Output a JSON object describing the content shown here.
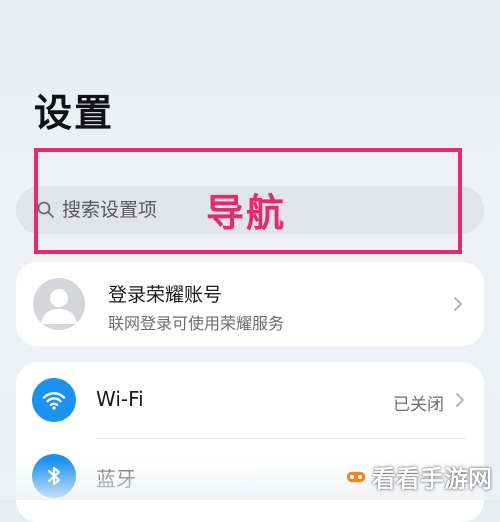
{
  "header": {
    "title": "设置"
  },
  "search": {
    "placeholder": "搜索设置项",
    "icon": "search-icon"
  },
  "annotation": {
    "label": "导航",
    "color": "#e52a6f"
  },
  "account": {
    "title": "登录荣耀账号",
    "subtitle": "联网登录可使用荣耀服务",
    "icon": "avatar-placeholder-icon"
  },
  "settings_list": [
    {
      "label": "Wi-Fi",
      "value": "已关闭",
      "icon": "wifi-icon",
      "icon_color": "#1b92f0"
    },
    {
      "label": "蓝牙",
      "icon": "bluetooth-icon",
      "icon_color": "#1b92f0"
    }
  ],
  "watermark": {
    "text": "看看手游网"
  },
  "colors": {
    "accent": "#1b92f0",
    "background": "#eceff3",
    "card": "#ffffff"
  }
}
